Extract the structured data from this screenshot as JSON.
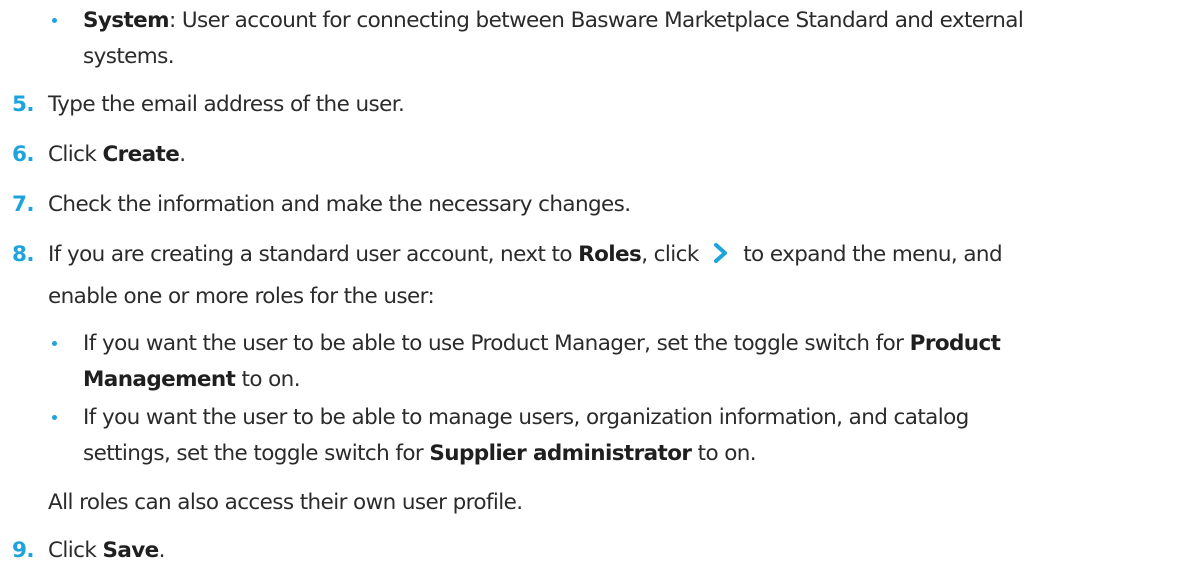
{
  "bullet_system": {
    "term": "System",
    "text_line1": ": User account for connecting between Basware Marketplace Standard and external",
    "text_line2": "systems."
  },
  "steps": [
    {
      "num": "5.",
      "text": "Type the email address of the user."
    },
    {
      "num": "6.",
      "pre": "Click ",
      "bold": "Create",
      "post": "."
    },
    {
      "num": "7.",
      "text": "Check the information and make the necessary changes."
    },
    {
      "num": "8.",
      "pre": "If you are creating a standard user account, next to ",
      "bold": "Roles",
      "mid": ", click ",
      "post": " to expand the menu, and",
      "line2": "enable one or more roles for the user:"
    },
    {
      "num": "9.",
      "pre": "Click ",
      "bold": "Save",
      "post": "."
    }
  ],
  "sub_bullets": [
    {
      "line1_pre": "If you want the user to be able to use Product Manager, set the toggle switch for ",
      "line1_bold": "Product",
      "line2_bold": "Management",
      "line2_post": " to on."
    },
    {
      "line1": "If you want the user to be able to manage users, organization information, and catalog",
      "line2_pre": "settings, set the toggle switch for ",
      "line2_bold": "Supplier administrator",
      "line2_post": " to on."
    }
  ],
  "note": "All roles can also access their own user profile.",
  "icons": {
    "expand": "chevron-right-icon"
  },
  "colors": {
    "accent": "#1fa3dd",
    "text": "#2b2b2b"
  }
}
